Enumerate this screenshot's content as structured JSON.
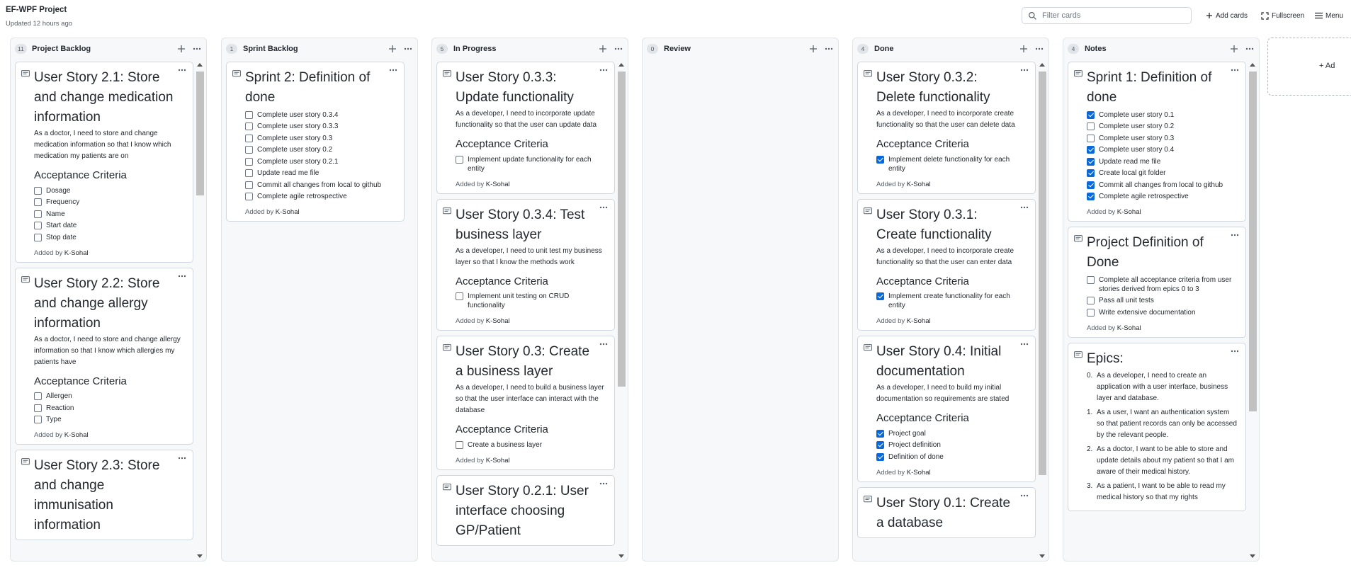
{
  "header": {
    "title": "EF-WPF Project",
    "updated": "Updated 12 hours ago",
    "filter_placeholder": "Filter cards",
    "add_cards": "Add cards",
    "fullscreen": "Fullscreen",
    "menu": "Menu",
    "add_column": "+ Ad"
  },
  "columns": [
    {
      "count": "11",
      "name": "Project Backlog",
      "cards": [
        {
          "title": "User Story 2.1: Store and change medication information",
          "desc": "As a doctor, I need to store and change medication information so that I know which medication my patients are on",
          "criteria": "Acceptance Criteria",
          "tasks": [
            {
              "text": "Dosage",
              "done": false
            },
            {
              "text": "Frequency",
              "done": false
            },
            {
              "text": "Name",
              "done": false
            },
            {
              "text": "Start date",
              "done": false
            },
            {
              "text": "Stop date",
              "done": false
            }
          ],
          "added_prefix": "Added by",
          "added_by": "K-Sohal"
        },
        {
          "title": "User Story 2.2: Store and change allergy information",
          "desc": "As a doctor, I need to store and change allergy information so that I know which allergies my patients have",
          "criteria": "Acceptance Criteria",
          "tasks": [
            {
              "text": "Allergen",
              "done": false
            },
            {
              "text": "Reaction",
              "done": false
            },
            {
              "text": "Type",
              "done": false
            }
          ],
          "added_prefix": "Added by",
          "added_by": "K-Sohal"
        },
        {
          "title": "User Story 2.3: Store and change immunisation information"
        }
      ]
    },
    {
      "count": "1",
      "name": "Sprint Backlog",
      "cards": [
        {
          "title": "Sprint 2: Definition of done",
          "tasks": [
            {
              "text": "Complete user story 0.3.4",
              "done": false
            },
            {
              "text": "Complete user story 0.3.3",
              "done": false
            },
            {
              "text": "Complete user story 0.3",
              "done": false
            },
            {
              "text": "Complete user story 0.2",
              "done": false
            },
            {
              "text": "Complete user story 0.2.1",
              "done": false
            },
            {
              "text": "Update read me file",
              "done": false
            },
            {
              "text": "Commit all changes from local to github",
              "done": false
            },
            {
              "text": "Complete agile retrospective",
              "done": false
            }
          ],
          "added_prefix": "Added by",
          "added_by": "K-Sohal"
        }
      ]
    },
    {
      "count": "5",
      "name": "In Progress",
      "cards": [
        {
          "title": "User Story 0.3.3: Update functionality",
          "desc": "As a developer, I need to incorporate update functionality so that the user can update data",
          "criteria": "Acceptance Criteria",
          "tasks": [
            {
              "text": "Implement update functionality for each entity",
              "done": false
            }
          ],
          "added_prefix": "Added by",
          "added_by": "K-Sohal"
        },
        {
          "title": "User Story 0.3.4: Test business layer",
          "desc": "As a developer, I need to unit test my business layer so that I know the methods work",
          "criteria": "Acceptance Criteria",
          "tasks": [
            {
              "text": "Implement unit testing on CRUD functionality",
              "done": false
            }
          ],
          "added_prefix": "Added by",
          "added_by": "K-Sohal"
        },
        {
          "title": "User Story 0.3: Create a business layer",
          "desc": "As a developer, I need to build a business layer so that the user interface can interact with the database",
          "criteria": "Acceptance Criteria",
          "tasks": [
            {
              "text": "Create a business layer",
              "done": false
            }
          ],
          "added_prefix": "Added by",
          "added_by": "K-Sohal"
        },
        {
          "title": "User Story 0.2.1: User interface choosing GP/Patient"
        }
      ]
    },
    {
      "count": "0",
      "name": "Review",
      "cards": []
    },
    {
      "count": "4",
      "name": "Done",
      "cards": [
        {
          "title": "User Story 0.3.2: Delete functionality",
          "desc": "As a developer, I need to incorporate create functionality so that the user can delete data",
          "criteria": "Acceptance Criteria",
          "tasks": [
            {
              "text": "Implement delete functionality for each entity",
              "done": true
            }
          ],
          "added_prefix": "Added by",
          "added_by": "K-Sohal"
        },
        {
          "title": "User Story 0.3.1: Create functionality",
          "desc": "As a developer, I need to incorporate create functionality so that the user can enter data",
          "criteria": "Acceptance Criteria",
          "tasks": [
            {
              "text": "Implement create functionality for each entity",
              "done": true
            }
          ],
          "added_prefix": "Added by",
          "added_by": "K-Sohal"
        },
        {
          "title": "User Story 0.4: Initial documentation",
          "desc": "As a developer, I need to build my initial documentation so requirements are stated",
          "criteria": "Acceptance Criteria",
          "tasks": [
            {
              "text": "Project goal",
              "done": true
            },
            {
              "text": "Project definition",
              "done": true
            },
            {
              "text": "Definition of done",
              "done": true
            }
          ],
          "added_prefix": "Added by",
          "added_by": "K-Sohal"
        },
        {
          "title": "User Story 0.1: Create a database"
        }
      ]
    },
    {
      "count": "4",
      "name": "Notes",
      "cards": [
        {
          "title": "Sprint 1: Definition of done",
          "tasks": [
            {
              "text": "Complete user story 0.1",
              "done": true
            },
            {
              "text": "Complete user story 0.2",
              "done": false
            },
            {
              "text": "Complete user story 0.3",
              "done": false
            },
            {
              "text": "Complete user story 0.4",
              "done": true
            },
            {
              "text": "Update read me file",
              "done": true
            },
            {
              "text": "Create local git folder",
              "done": true
            },
            {
              "text": "Commit all changes from local to github",
              "done": true
            },
            {
              "text": "Complete agile retrospective",
              "done": true
            }
          ],
          "added_prefix": "Added by",
          "added_by": "K-Sohal"
        },
        {
          "title": "Project Definition of Done",
          "tasks": [
            {
              "text": "Complete all acceptance criteria from user stories derived from epics 0 to 3",
              "done": false
            },
            {
              "text": "Pass all unit tests",
              "done": false
            },
            {
              "text": "Write extensive documentation",
              "done": false
            }
          ],
          "added_prefix": "Added by",
          "added_by": "K-Sohal"
        },
        {
          "title": "Epics:",
          "epics": [
            {
              "num": "0.",
              "text": "As a developer, I need to create an application with a user interface, business layer and database."
            },
            {
              "num": "1.",
              "text": "As a user, I want an authentication system so that patient records can only be accessed by the relevant people."
            },
            {
              "num": "2.",
              "text": "As a doctor, I want to be able to store and update details about my patient so that I am aware of their medical history."
            },
            {
              "num": "3.",
              "text": "As a patient, I want to be able to read my medical history so that my rights"
            }
          ]
        }
      ]
    }
  ]
}
